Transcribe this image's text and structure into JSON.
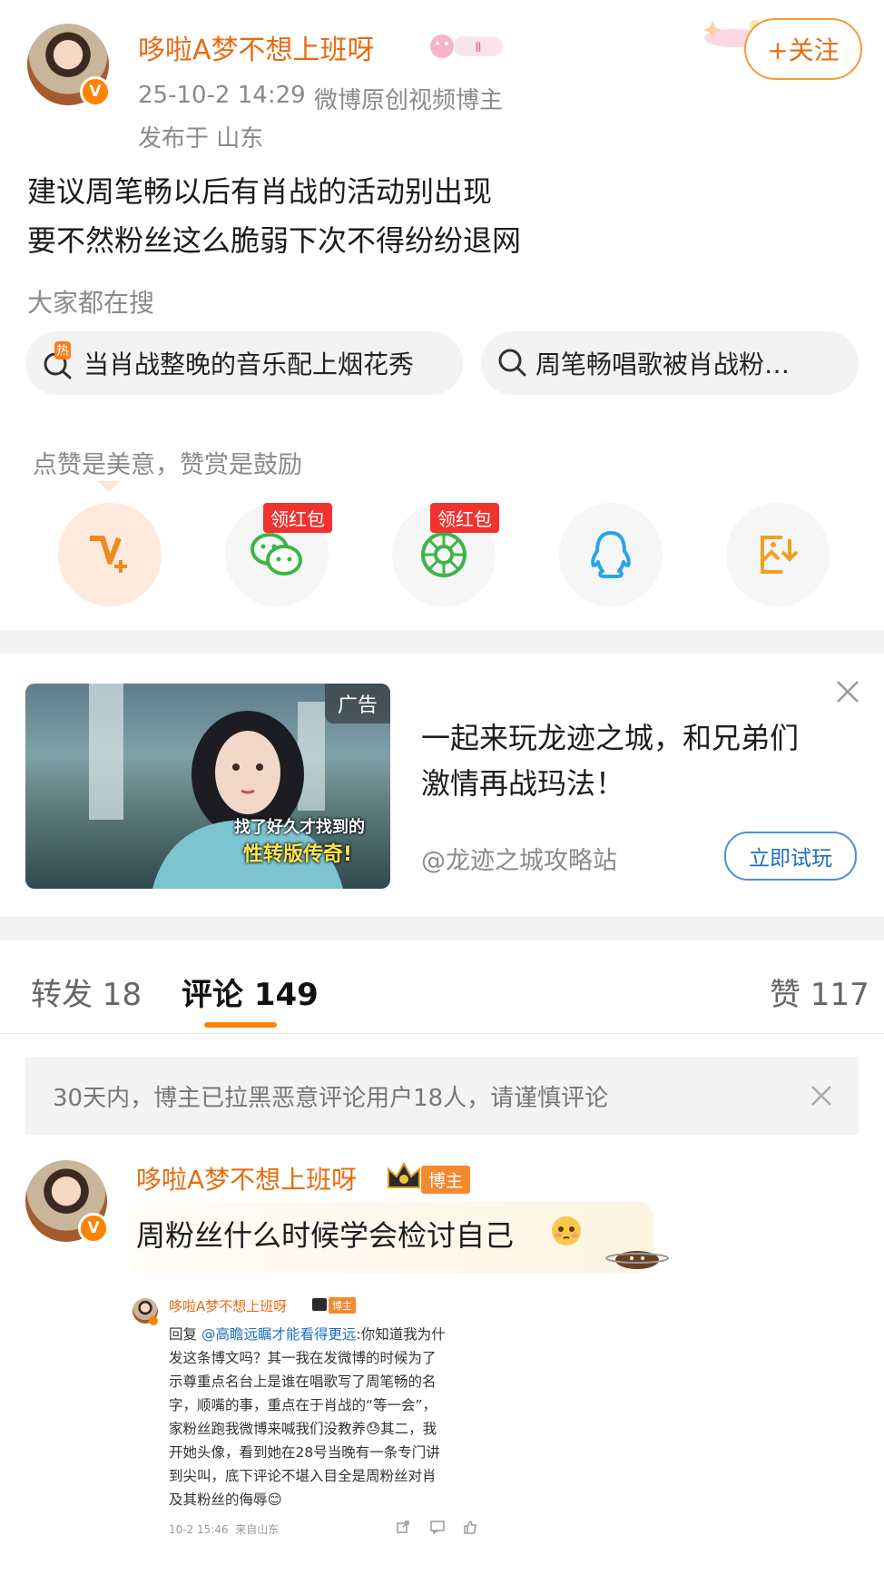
{
  "post": {
    "author": "哆啦A梦不想上班呀",
    "date": "25-10-2 14:29",
    "author_tag": "微博原创视频博主",
    "location": "发布于 山东",
    "follow_label": "+关注",
    "text_line1": "建议周笔畅以后有肖战的活动别出现",
    "text_line2": "要不然粉丝这么脆弱下次不得纷纷退网"
  },
  "search": {
    "label": "大家都在搜",
    "hot_badge": "热",
    "items": [
      "当肖战整晚的音乐配上烟花秀",
      "周笔畅唱歌被肖战粉…"
    ]
  },
  "share": {
    "hint": "点赞是美意，赞赏是鼓励",
    "red_packet_tag": "领红包",
    "icons": [
      "v-plus-icon",
      "wechat-icon",
      "moments-icon",
      "qq-icon",
      "save-image-icon"
    ]
  },
  "ad": {
    "badge": "广告",
    "image_caption_line1": "找了好久才找到的",
    "image_caption_line2": "性转版传奇!",
    "title_line1": "一起来玩龙迹之城，和兄弟们",
    "title_line2": "激情再战玛法！",
    "source": "@龙迹之城攻略站",
    "button": "立即试玩"
  },
  "tabs": {
    "repost": "转发 18",
    "comments": "评论 149",
    "likes": "赞 117"
  },
  "notice": {
    "text": "30天内，博主已拉黑恶意评论用户18人，请谨慎评论"
  },
  "comment": {
    "author": "哆啦A梦不想上班呀",
    "author_badge": "博主",
    "text": "周粉丝什么时候学会检讨自己",
    "screenshot": {
      "author": "哆啦A梦不想上班呀",
      "badge": "博主",
      "reply_prefix": "回复",
      "mention": "@高瞻远瞩才能看得更远",
      "lines": [
        ":你知道我为什",
        "发这条博文吗？其一我在发微博的时候为了",
        "示尊重点名台上是谁在唱歌写了周笔畅的名",
        "字，顺嘴的事，重点在于肖战的“等一会”，",
        "家粉丝跑我微博来喊我们没教养😓其二，我",
        "开她头像，看到她在28号当晚有一条专门讲",
        "到尖叫，底下评论不堪入目全是周粉丝对肖",
        "及其粉丝的侮辱😊"
      ],
      "footer": "10-2 15:46  来自山东"
    }
  },
  "colors": {
    "accent": "#ff8200",
    "name_orange": "#e86b0f",
    "red_tag": "#f0332f",
    "link_blue": "#1e6fbd"
  }
}
